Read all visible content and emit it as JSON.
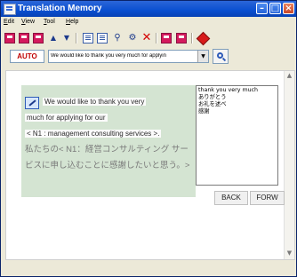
{
  "window": {
    "title": "Translation Memory",
    "controls": [
      "minimize",
      "maximize",
      "close"
    ]
  },
  "menu": [
    "Edit",
    "View",
    "Tool",
    "Help"
  ],
  "toolbar": {
    "icons": [
      "pink-block-icon",
      "pink-block-icon",
      "pink-block-icon",
      "up-arrow-icon",
      "down-arrow-icon",
      "document-icon",
      "document-icon",
      "tool-icon",
      "tool-icon",
      "delete-icon",
      "pink-block-icon",
      "pink-block-icon",
      "red-gem-icon"
    ]
  },
  "search": {
    "auto_label": "AUTO",
    "query": "We would like to thank you very much for applyin",
    "button_icon": "magnifier-icon"
  },
  "source": {
    "lines": [
      "We would like to thank you very",
      "much for applying for our",
      "< N1 : management consulting services >.",
      "私たちの< N1：経営コンサルティング サー",
      "ビスに申し込むことに感謝したいと思う。>"
    ]
  },
  "results": [
    "thank you very much",
    "ありがとう",
    "お礼を述べ",
    "感謝"
  ],
  "nav": {
    "back": "BACK",
    "forward": "FORW"
  }
}
